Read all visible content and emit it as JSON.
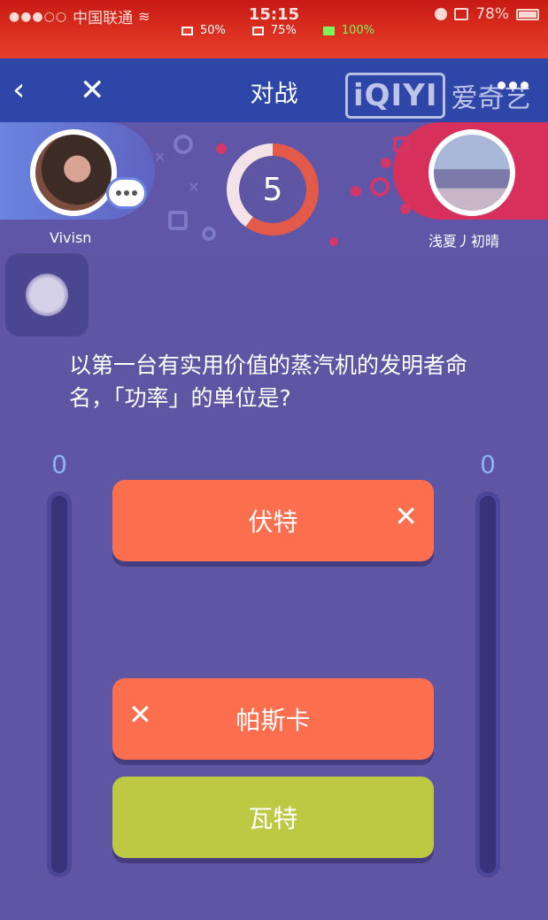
{
  "status_bar": {
    "carrier": "中国联通",
    "time": "15:15",
    "battery_text": "78%",
    "metrics": [
      "50%",
      "75%",
      "100%"
    ]
  },
  "nav": {
    "title": "对战"
  },
  "watermark": {
    "logo": "iQIYI",
    "text": "爱奇艺"
  },
  "battle": {
    "player_left": {
      "name": "Vivisn"
    },
    "player_right": {
      "name": "浅夏丿初晴"
    },
    "timer": "5",
    "timer_progress": 0.6
  },
  "question": {
    "text": "以第一台有实用价值的蒸汽机的发明者命名，「功率」的单位是?"
  },
  "scores": {
    "left": "0",
    "right": "0"
  },
  "options": [
    {
      "label": "伏特",
      "state": "wrong",
      "mark": "✕"
    },
    {
      "label": "帕斯卡",
      "state": "wrong",
      "mark": "✕"
    },
    {
      "label": "瓦特",
      "state": "correct",
      "mark": ""
    }
  ],
  "colors": {
    "background": "#5e55a3",
    "status_bar": "#e8402c",
    "nav_bar": "#2e46a8",
    "option_wrong": "#fb6e4e",
    "option_correct": "#bdc843",
    "score": "#8fb3f2"
  }
}
